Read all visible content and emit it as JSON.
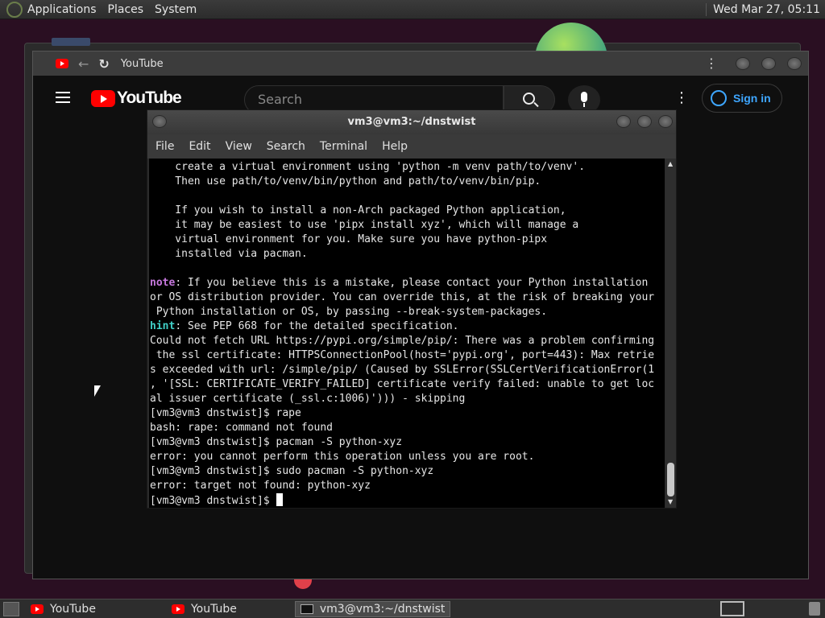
{
  "top_panel": {
    "menus": [
      "Applications",
      "Places",
      "System"
    ],
    "clock": "Wed Mar 27, 05:11"
  },
  "browser": {
    "tab_title": "YouTube",
    "youtube": {
      "logo_text": "YouTube",
      "search_placeholder": "Search",
      "sign_in_label": "Sign in"
    }
  },
  "terminal": {
    "title": "vm3@vm3:~/dnstwist",
    "menu": [
      "File",
      "Edit",
      "View",
      "Search",
      "Terminal",
      "Help"
    ],
    "lines_top": [
      "    create a virtual environment using 'python -m venv path/to/venv'.",
      "    Then use path/to/venv/bin/python and path/to/venv/bin/pip.",
      "",
      "    If you wish to install a non-Arch packaged Python application,",
      "    it may be easiest to use 'pipx install xyz', which will manage a",
      "    virtual environment for you. Make sure you have python-pipx",
      "    installed via pacman.",
      ""
    ],
    "note_label": "note",
    "note_lines": [
      ": If you believe this is a mistake, please contact your Python installation",
      "or OS distribution provider. You can override this, at the risk of breaking your",
      " Python installation or OS, by passing --break-system-packages."
    ],
    "hint_label": "hint",
    "hint_line": ": See PEP 668 for the detailed specification.",
    "lines_bottom": [
      "Could not fetch URL https://pypi.org/simple/pip/: There was a problem confirming",
      " the ssl certificate: HTTPSConnectionPool(host='pypi.org', port=443): Max retrie",
      "s exceeded with url: /simple/pip/ (Caused by SSLError(SSLCertVerificationError(1",
      ", '[SSL: CERTIFICATE_VERIFY_FAILED] certificate verify failed: unable to get loc",
      "al issuer certificate (_ssl.c:1006)'))) - skipping",
      "[vm3@vm3 dnstwist]$ rape",
      "bash: rape: command not found",
      "[vm3@vm3 dnstwist]$ pacman -S python-xyz",
      "error: you cannot perform this operation unless you are root.",
      "[vm3@vm3 dnstwist]$ sudo pacman -S python-xyz",
      "error: target not found: python-xyz"
    ],
    "prompt": "[vm3@vm3 dnstwist]$ "
  },
  "taskbar": {
    "tasks": [
      "YouTube",
      "YouTube",
      "vm3@vm3:~/dnstwist"
    ]
  },
  "icons": {
    "menu": "gnome-foot-icon",
    "search": "search-icon",
    "mic": "microphone-icon",
    "user": "user-icon"
  },
  "colors": {
    "youtube_red": "#ff0000",
    "signin_blue": "#3ea6ff",
    "note": "#c678dd",
    "hint": "#40d0c8"
  }
}
